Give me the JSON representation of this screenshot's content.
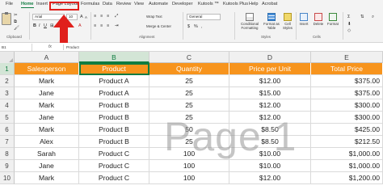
{
  "tabs": [
    "File",
    "Home",
    "Insert",
    "Page Layout",
    "Formulas",
    "Data",
    "Review",
    "View",
    "Automate",
    "Developer",
    "Kutools ™",
    "Kutools Plus",
    "Help",
    "Acrobat"
  ],
  "ribbon": {
    "font_name": "Arial",
    "font_size": "10",
    "wrap_text": "Wrap Text",
    "merge_center": "Merge & Center",
    "number_format": "General",
    "conditional_formatting": "Conditional Formatting",
    "format_as_table": "Format as Table",
    "cell_styles": "Cell Styles",
    "insert": "Insert",
    "delete": "Delete",
    "format": "Format",
    "groups": {
      "clipboard": "Clipboard",
      "alignment": "Alignment",
      "styles": "Styles",
      "cells": "Cells"
    }
  },
  "formula_bar": {
    "name_box": "B1",
    "fx": "fx",
    "content": "Product"
  },
  "columns": [
    "A",
    "B",
    "C",
    "D",
    "E"
  ],
  "rows": [
    "1",
    "2",
    "3",
    "4",
    "5",
    "6",
    "7",
    "8",
    "9",
    "10"
  ],
  "table": {
    "headers": [
      "Salesperson",
      "Product",
      "Quantity",
      "Price per Unit",
      "Total Price"
    ],
    "data": [
      [
        "Mark",
        "Product A",
        "25",
        "$12.00",
        "$375.00"
      ],
      [
        "Jane",
        "Product A",
        "25",
        "$15.00",
        "$375.00"
      ],
      [
        "Mark",
        "Product B",
        "25",
        "$12.00",
        "$300.00"
      ],
      [
        "Jane",
        "Product B",
        "25",
        "$12.00",
        "$300.00"
      ],
      [
        "Mark",
        "Product B",
        "50",
        "$8.50",
        "$425.00"
      ],
      [
        "Alex",
        "Product B",
        "25",
        "$8.50",
        "$212.50"
      ],
      [
        "Sarah",
        "Product C",
        "100",
        "$10.00",
        "$1,000.00"
      ],
      [
        "Jane",
        "Product C",
        "100",
        "$10.00",
        "$1,000.00"
      ],
      [
        "Mark",
        "Product C",
        "100",
        "$12.00",
        "$1,200.00"
      ]
    ]
  },
  "watermark": "Page 1",
  "colors": {
    "header_fill": "#f7941d",
    "accent": "#107c41",
    "annotation": "#e0201c"
  }
}
